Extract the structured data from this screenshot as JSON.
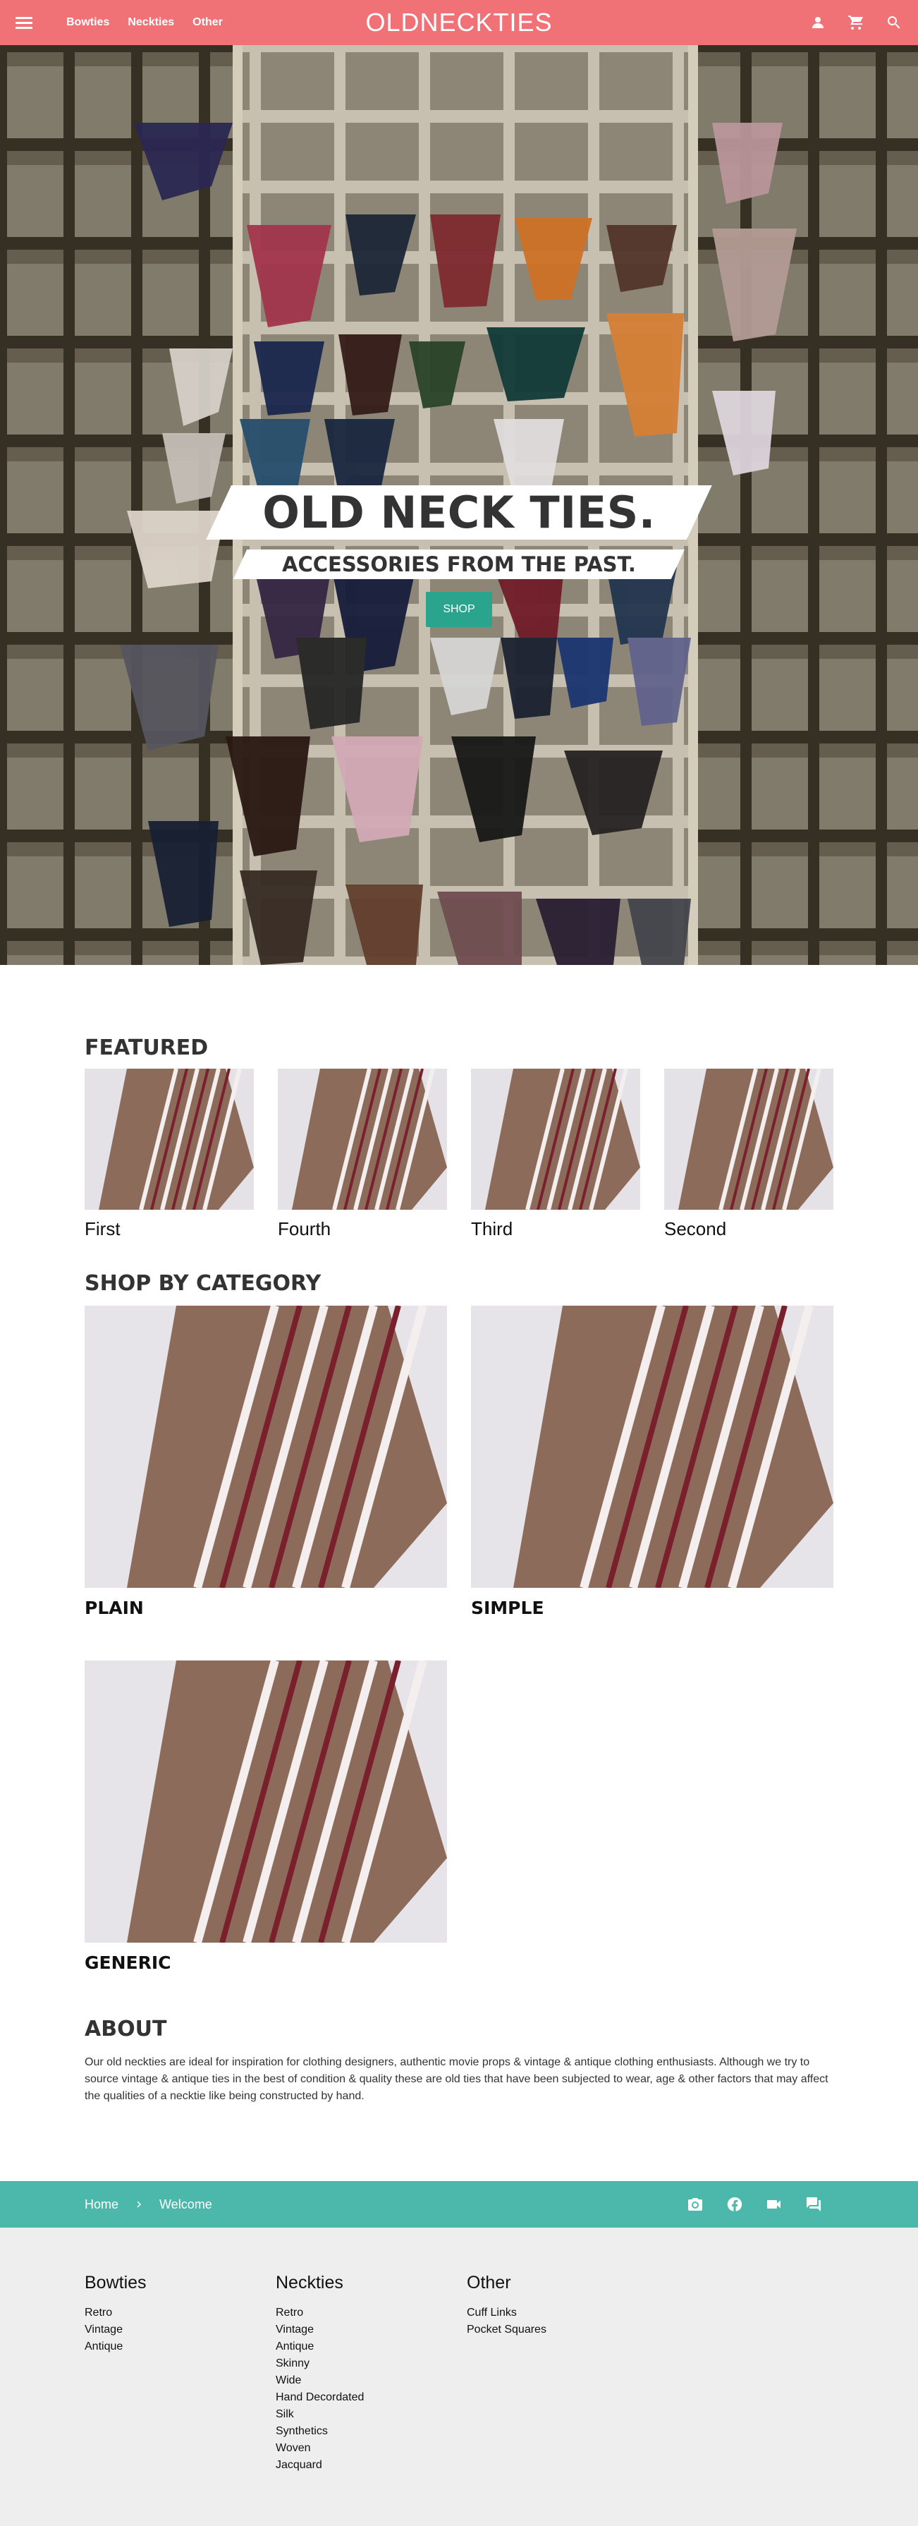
{
  "header": {
    "brand": "OLDNECKTIES",
    "nav": [
      "Bowties",
      "Neckties",
      "Other"
    ]
  },
  "hero": {
    "title": "OLD NECK TIES.",
    "subtitle": "ACCESSORIES FROM THE PAST.",
    "cta": "SHOP"
  },
  "featured": {
    "title": "FEATURED",
    "items": [
      "First",
      "Fourth",
      "Third",
      "Second"
    ]
  },
  "categories": {
    "title": "SHOP BY CATEGORY",
    "items": [
      "PLAIN",
      "SIMPLE",
      "GENERIC"
    ]
  },
  "about": {
    "title": "ABOUT",
    "text": "Our old neckties are ideal for inspiration for clothing designers, authentic movie props & vintage & antique clothing enthusiasts. Although we try to source vintage & antique ties in the best of condition & quality these are old ties that have been subjected to wear, age & other factors that may affect the qualities of a necktie like being constructed by hand."
  },
  "breadcrumb": [
    "Home",
    "Welcome"
  ],
  "footer": {
    "columns": [
      {
        "title": "Bowties",
        "links": [
          "Retro",
          "Vintage",
          "Antique"
        ]
      },
      {
        "title": "Neckties",
        "links": [
          "Retro",
          "Vintage",
          "Antique",
          "Skinny",
          "Wide",
          "Hand Decordated",
          "Silk",
          "Synthetics",
          "Woven",
          "Jacquard"
        ]
      },
      {
        "title": "Other",
        "links": [
          "Cuff Links",
          "Pocket Squares"
        ]
      }
    ]
  },
  "colors": {
    "header": "#f07277",
    "accent": "#2aa48d",
    "breadcrumb_bar": "#4bb8ab",
    "footer_bg": "#eeeeee"
  }
}
